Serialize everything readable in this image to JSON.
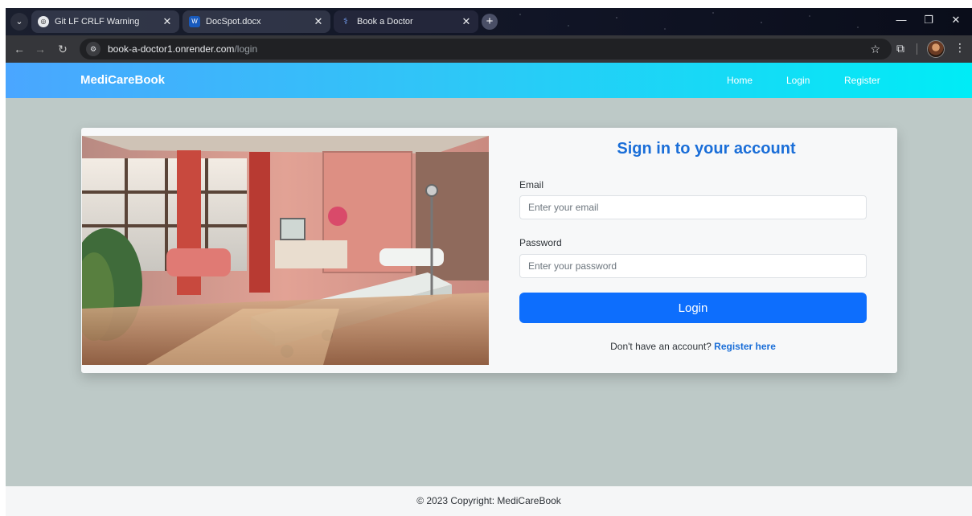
{
  "browser": {
    "tabs": [
      {
        "title": "Git LF CRLF Warning",
        "favicon": "chatgpt-icon",
        "active": false
      },
      {
        "title": "DocSpot.docx",
        "favicon": "word-icon",
        "favicon_letter": "W",
        "active": false
      },
      {
        "title": "Book a Doctor",
        "favicon": "stethoscope-icon",
        "active": true
      }
    ],
    "url_host": "book-a-doctor1.onrender.com",
    "url_path": "/login"
  },
  "navbar": {
    "brand": "MediCareBook",
    "links": [
      "Home",
      "Login",
      "Register"
    ]
  },
  "login": {
    "heading": "Sign in to your account",
    "email_label": "Email",
    "email_placeholder": "Enter your email",
    "password_label": "Password",
    "password_placeholder": "Enter your password",
    "login_button": "Login",
    "no_account_text": "Don't have an account?",
    "register_link": "Register here"
  },
  "footer": {
    "text": "© 2023 Copyright: MediCareBook"
  },
  "colors": {
    "primary": "#0d6efd",
    "heading": "#1a6ed8",
    "navbar_start": "#4aa6ff",
    "navbar_end": "#00ecf6",
    "page_bg": "#bdc9c7"
  }
}
